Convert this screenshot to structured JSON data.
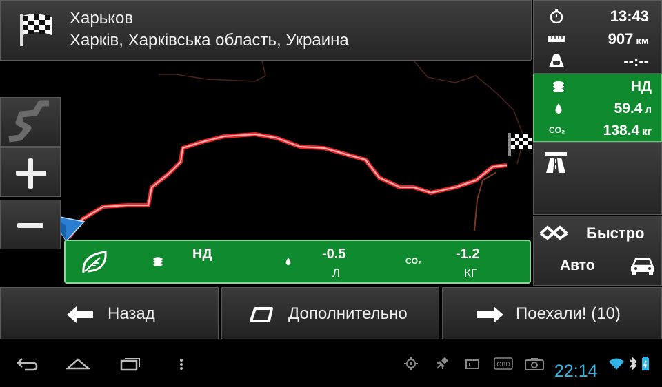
{
  "destination": {
    "city": "Харьков",
    "address": "Харків, Харківська область, Украина",
    "icon": "checkered-flag-icon"
  },
  "trip_info": {
    "time": "13:43",
    "distance": "907",
    "distance_unit": "км",
    "eta": "--:--"
  },
  "consumption": {
    "cost": "НД",
    "fuel": "59.4",
    "fuel_unit": "л",
    "co2_label": "CO₂",
    "co2": "138.4",
    "co2_unit": "кг"
  },
  "route_mode": {
    "method": "Быстро",
    "vehicle": "Авто"
  },
  "eco_bar": {
    "cost": "НД",
    "fuel": "-0.5",
    "fuel_unit": "Л",
    "co2_label": "CO₂",
    "co2": "-1.2",
    "co2_unit": "КГ"
  },
  "bottom_bar": {
    "back": "Назад",
    "more": "Дополнительно",
    "go": "Поехали! (10)"
  },
  "status_bar": {
    "clock": "22:14",
    "obd": "OBD"
  },
  "colors": {
    "accent_green": "#0f8a2e",
    "route": "#e8262a",
    "clock": "#33b5e5"
  }
}
